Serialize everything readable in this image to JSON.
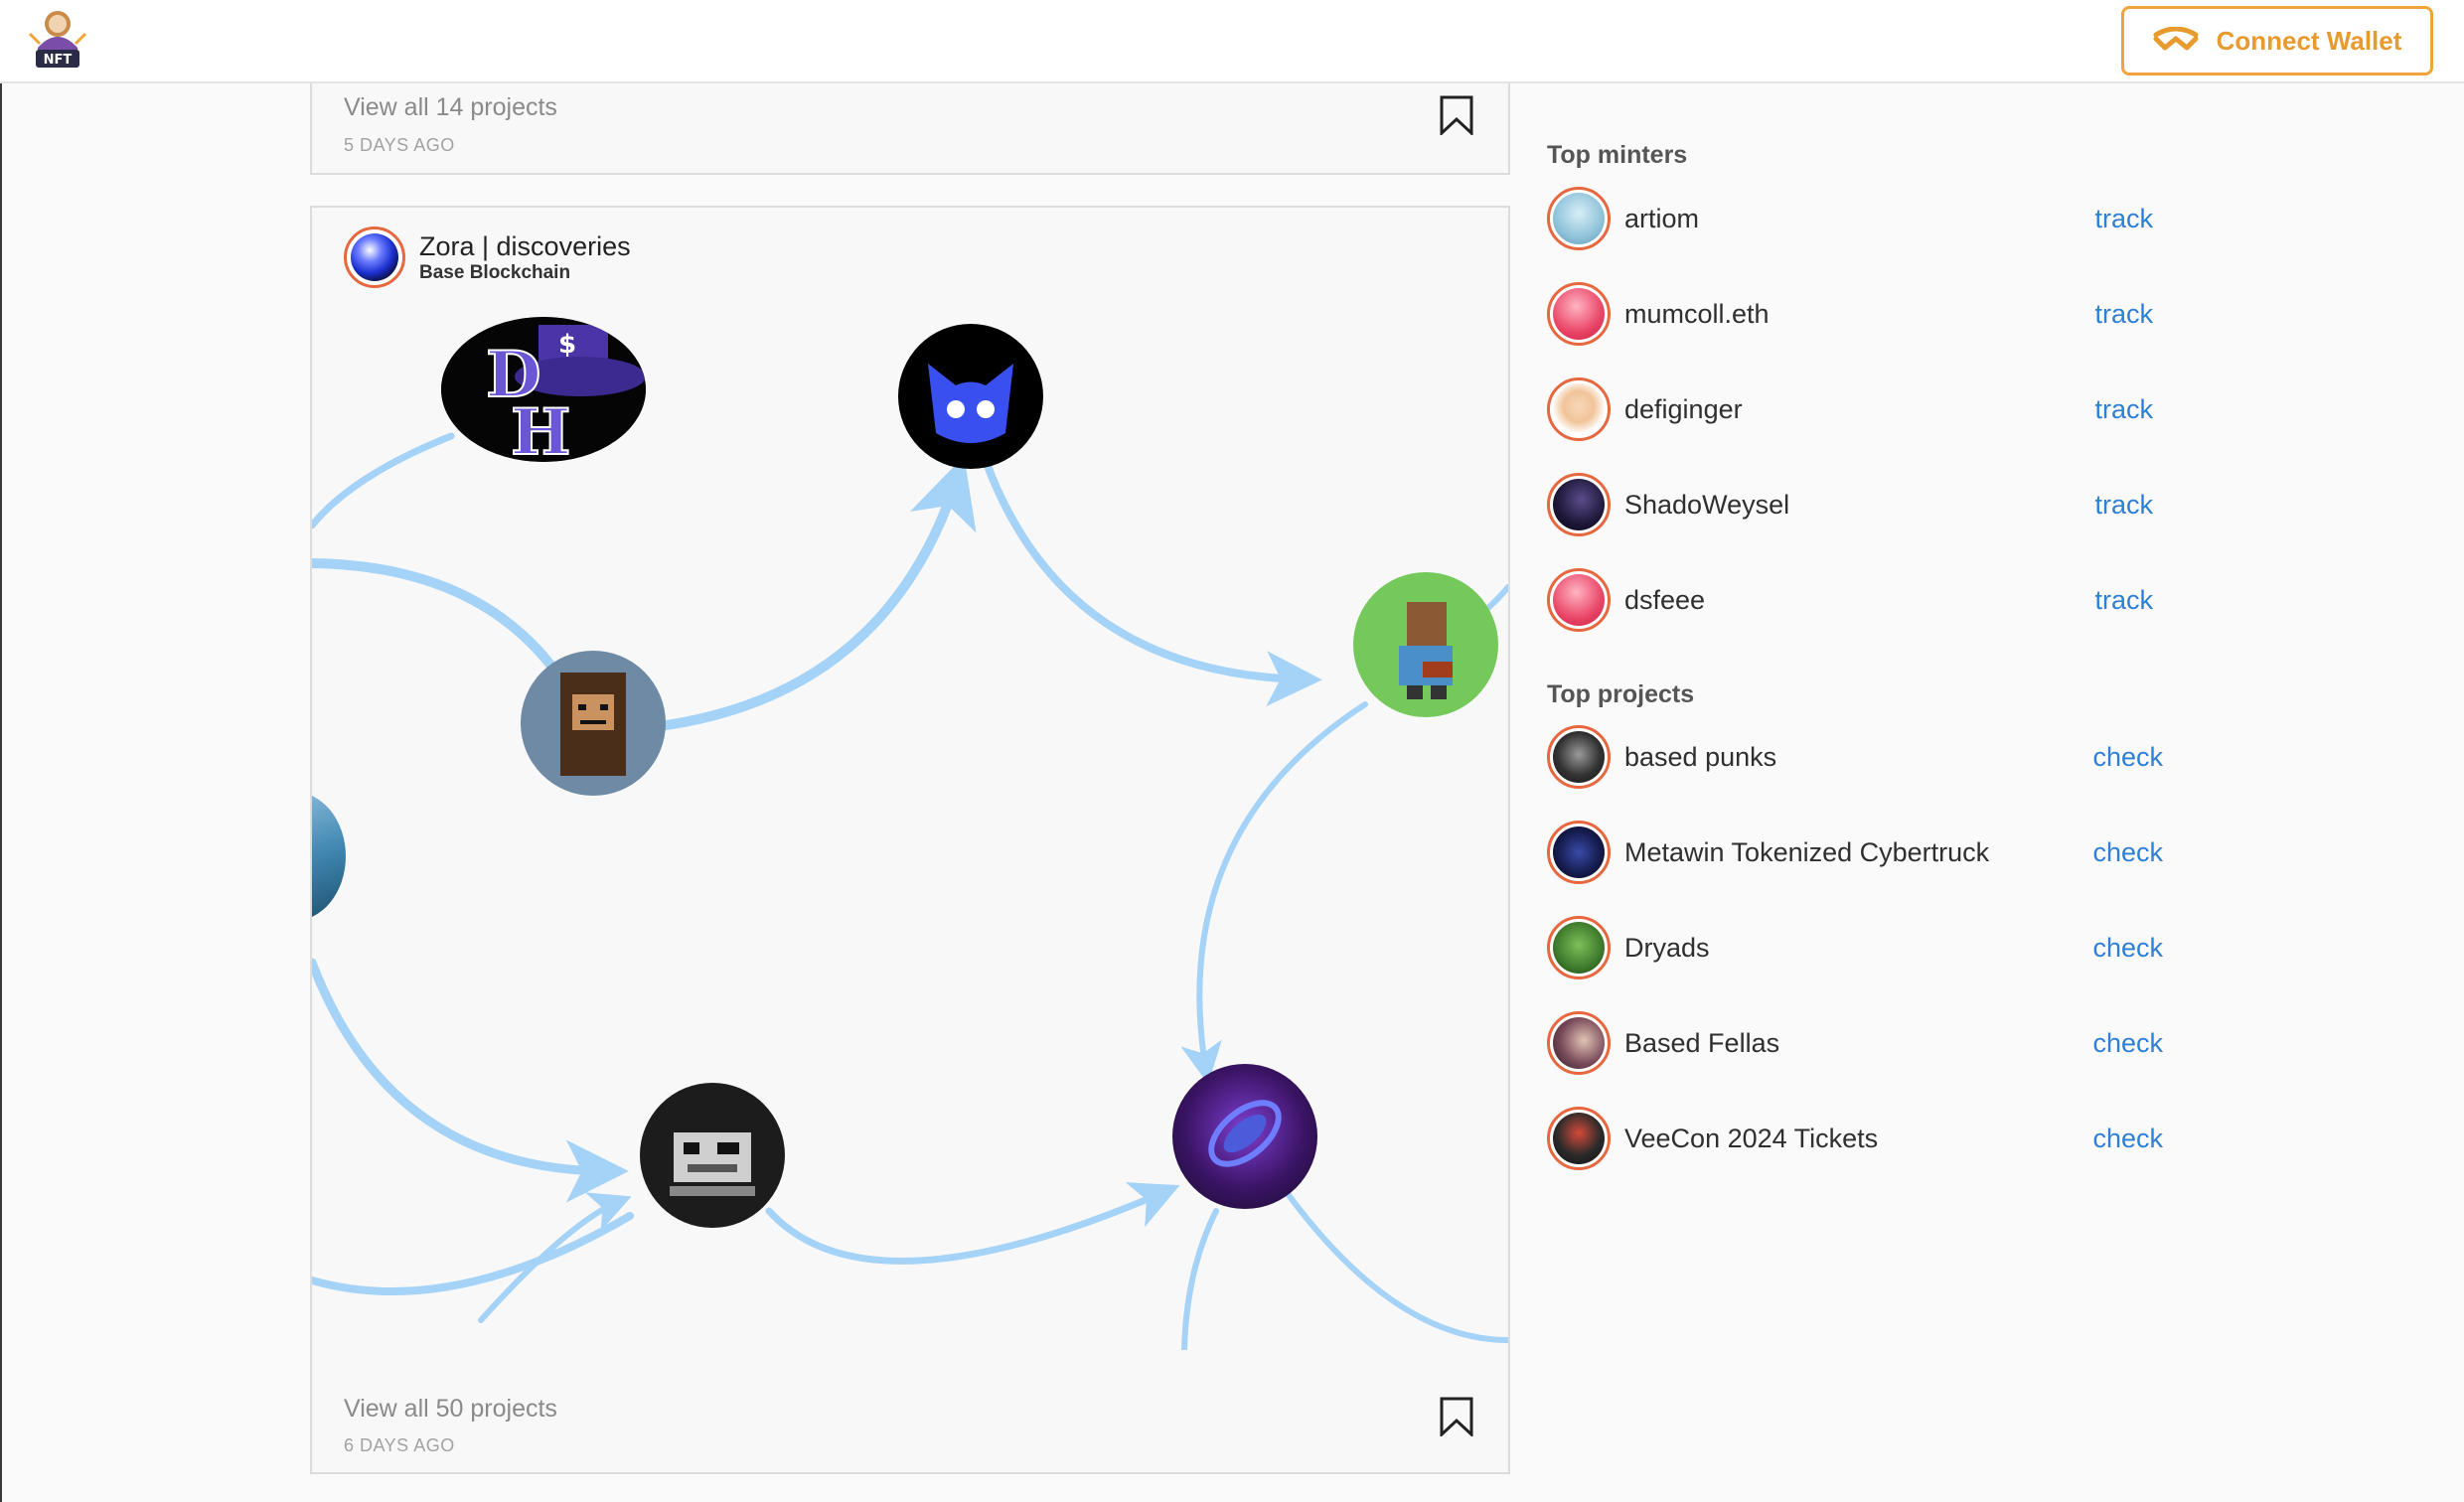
{
  "header": {
    "logo_text": "NFT",
    "connect_label": "Connect Wallet"
  },
  "colors": {
    "accent_orange": "#f0a43a",
    "link_blue": "#2f7fd6",
    "edge_blue": "#a5d2f7",
    "avatar_ring": "#e7673f"
  },
  "feed": {
    "card1": {
      "view_all": "View all 14 projects",
      "time_ago": "5 DAYS AGO"
    },
    "card2": {
      "title": "Zora | discoveries",
      "subtitle": "Base Blockchain",
      "view_all": "View all 50 projects",
      "time_ago": "6 DAYS AGO"
    }
  },
  "sidebar": {
    "minters_title": "Top minters",
    "minters": [
      {
        "name": "artiom",
        "action": "track"
      },
      {
        "name": "mumcoll.eth",
        "action": "track"
      },
      {
        "name": "defiginger",
        "action": "track"
      },
      {
        "name": "ShadoWeysel",
        "action": "track"
      },
      {
        "name": "dsfeee",
        "action": "track"
      }
    ],
    "projects_title": "Top projects",
    "projects": [
      {
        "name": "based punks",
        "action": "check"
      },
      {
        "name": "Metawin Tokenized Cybertruck",
        "action": "check"
      },
      {
        "name": "Dryads",
        "action": "check"
      },
      {
        "name": "Based Fellas",
        "action": "check"
      },
      {
        "name": "VeeCon 2024 Tickets",
        "action": "check"
      }
    ]
  }
}
